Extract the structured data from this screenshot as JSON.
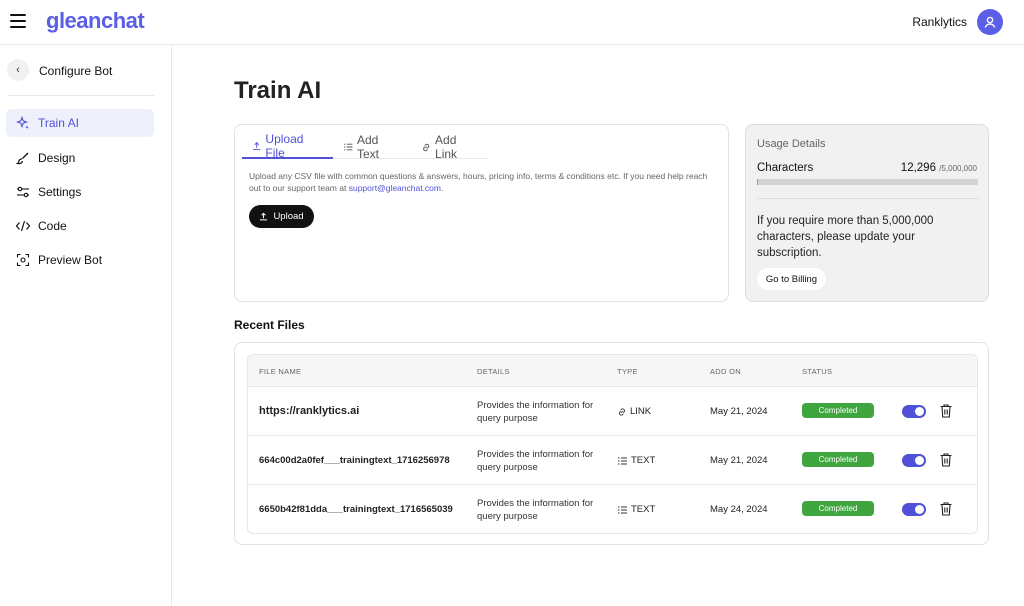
{
  "header": {
    "logo": "gleanchat",
    "account_name": "Ranklytics"
  },
  "sidebar": {
    "title": "Configure Bot",
    "items": [
      {
        "label": "Train AI",
        "icon": "sparkle-icon",
        "active": true
      },
      {
        "label": "Design",
        "icon": "brush-icon",
        "active": false
      },
      {
        "label": "Settings",
        "icon": "sliders-icon",
        "active": false
      },
      {
        "label": "Code",
        "icon": "code-icon",
        "active": false
      },
      {
        "label": "Preview Bot",
        "icon": "preview-icon",
        "active": false
      }
    ]
  },
  "main": {
    "title": "Train AI",
    "tabs": [
      {
        "label": "Upload File",
        "active": true
      },
      {
        "label": "Add Text",
        "active": false
      },
      {
        "label": "Add Link",
        "active": false
      }
    ],
    "help_text": "Upload any CSV file with common questions & answers, hours, pricing info, terms & conditions etc. If you need help reach out to our support team at",
    "help_email": "support@gleanchat.com",
    "help_suffix": ".",
    "upload_label": "Upload"
  },
  "usage": {
    "title": "Usage Details",
    "characters_label": "Characters",
    "characters_used": "12,296",
    "characters_max": "/5,000,000",
    "progress_fraction": 0.0025,
    "note": "If you require more than 5,000,000 characters, please update your subscription.",
    "billing_label": "Go to Billing"
  },
  "recent": {
    "title": "Recent Files",
    "columns": [
      "FILE NAME",
      "DETAILS",
      "TYPE",
      "ADD ON",
      "STATUS"
    ],
    "rows": [
      {
        "file_name": "https://ranklytics.ai",
        "details": "Provides the information for query purpose",
        "type": "LINK",
        "type_icon": "link-icon",
        "added": "May 21, 2024",
        "status": "Completed",
        "enabled": true
      },
      {
        "file_name": "664c00d2a0fef___trainingtext_1716256978",
        "details": "Provides the information for query purpose",
        "type": "TEXT",
        "type_icon": "text-icon",
        "added": "May 21, 2024",
        "status": "Completed",
        "enabled": true
      },
      {
        "file_name": "6650b42f81dda___trainingtext_1716565039",
        "details": "Provides the information for query purpose",
        "type": "TEXT",
        "type_icon": "text-icon",
        "added": "May 24, 2024",
        "status": "Completed",
        "enabled": true
      }
    ]
  },
  "colors": {
    "accent": "#4f52d9",
    "status_completed": "#3fa63f"
  }
}
